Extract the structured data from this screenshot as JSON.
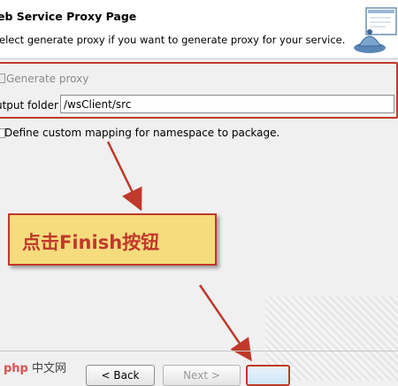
{
  "header": {
    "title": "eb Service Proxy Page",
    "description": "elect generate proxy if you want to generate proxy for your service.",
    "banner_icon": "wizard-banner-icon"
  },
  "form": {
    "generate_label": "Generate proxy",
    "generate_checked": false,
    "output_label": "utput folder",
    "output_value": "/wsClient/src",
    "mapping_label": "Define custom mapping for namespace to package.",
    "mapping_checked": false
  },
  "callout": {
    "text": "点击Finish按钮"
  },
  "buttons": {
    "back_label": "< Back",
    "next_label": "Next >",
    "finish_label": ""
  },
  "watermark": {
    "icon": "php",
    "text": "中文网"
  },
  "colors": {
    "annotation_red": "#c0392b",
    "callout_fill": "#f6dc7d"
  }
}
